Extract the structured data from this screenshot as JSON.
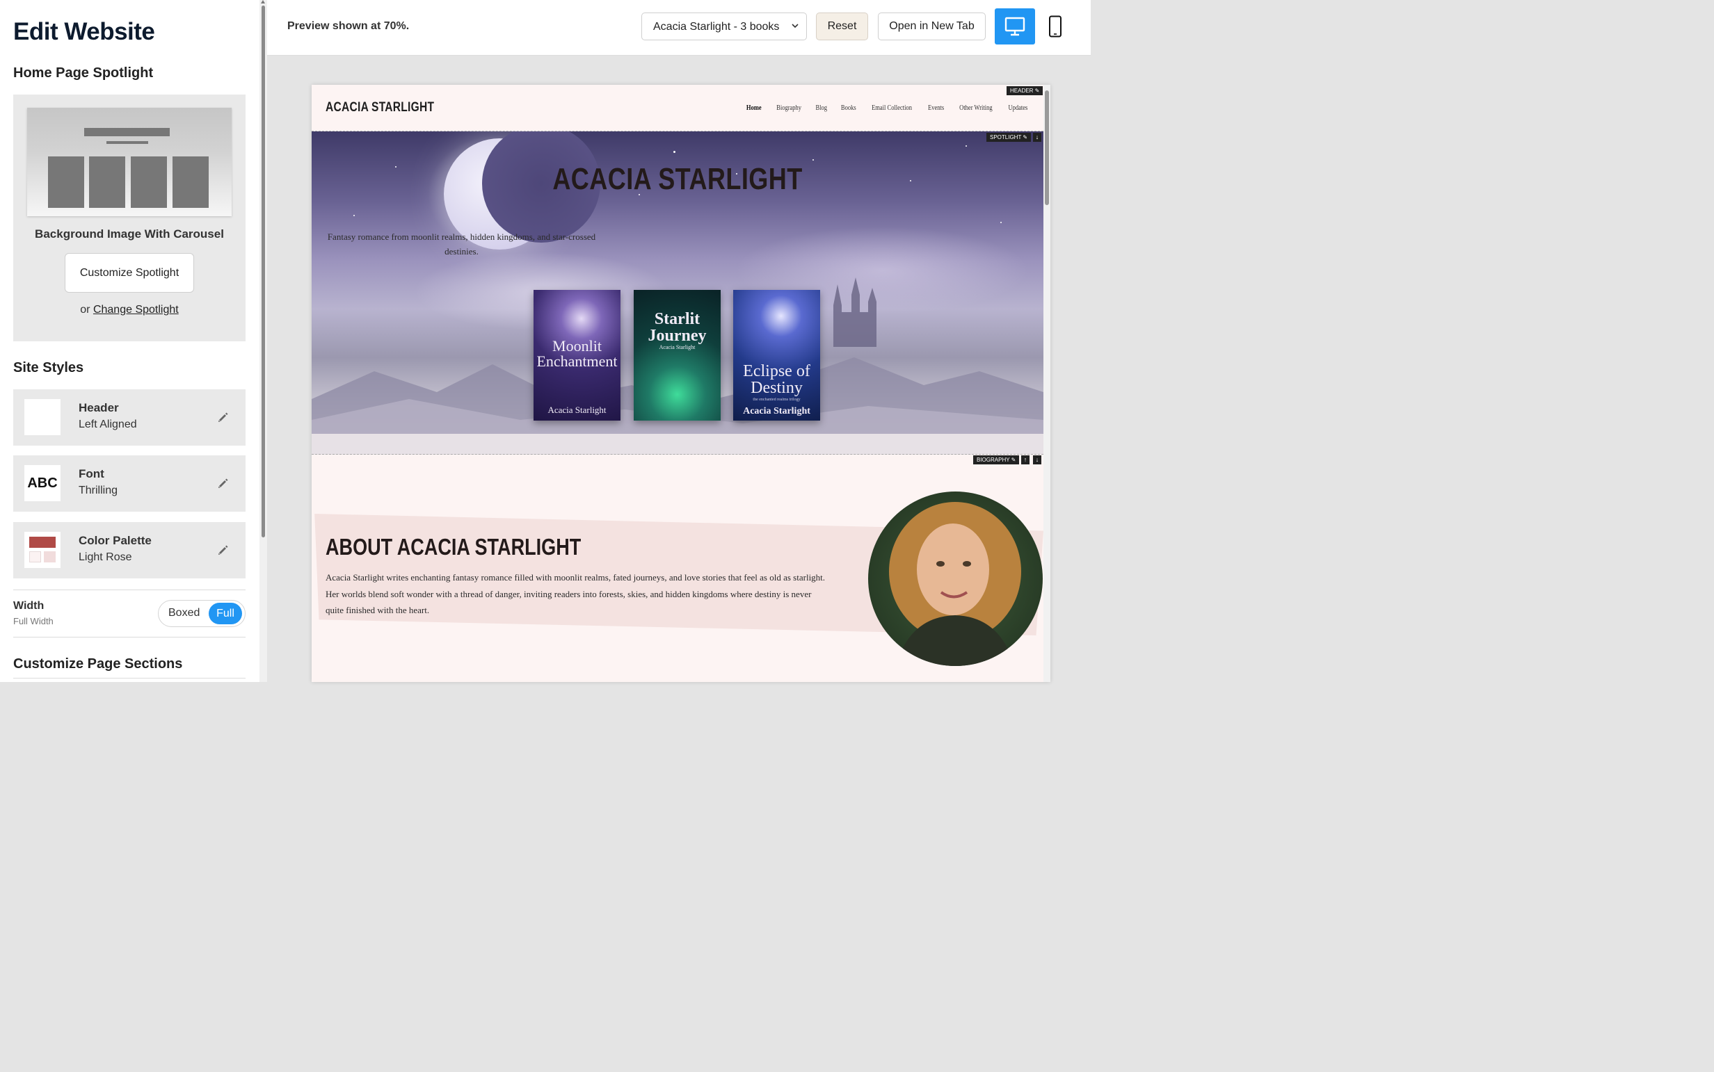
{
  "sidebar": {
    "title": "Edit Website",
    "spotlight": {
      "heading": "Home Page Spotlight",
      "name": "Background Image With Carousel",
      "customize_label": "Customize Spotlight",
      "or_text": "or",
      "change_label": "Change Spotlight"
    },
    "site_styles": {
      "heading": "Site Styles",
      "header": {
        "name": "Header",
        "value": "Left Aligned"
      },
      "font": {
        "name": "Font",
        "value": "Thrilling",
        "sample": "ABC"
      },
      "palette": {
        "name": "Color Palette",
        "value": "Light Rose",
        "colors": [
          "#b04a46",
          "#fbf2f2",
          "#f1dcdc"
        ]
      }
    },
    "width": {
      "label": "Width",
      "value": "Full Width",
      "options": [
        "Boxed",
        "Full"
      ],
      "selected": "Full"
    },
    "sections_heading": "Customize Page Sections"
  },
  "topbar": {
    "preview_text": "Preview shown at 70%.",
    "select_value": "Acacia Starlight - 3 books",
    "reset_label": "Reset",
    "new_tab_label": "Open in New Tab",
    "accent": "#2196f3"
  },
  "site": {
    "logo": "ACACIA STARLIGHT",
    "nav": [
      "Home",
      "Biography",
      "Blog",
      "Books",
      "Email Collection",
      "Events",
      "Other Writing",
      "Updates"
    ],
    "tags": {
      "header": "HEADER ✎",
      "spotlight": "SPOTLIGHT ✎",
      "biography": "BIOGRAPHY ✎",
      "up": "↑",
      "down": "↓"
    },
    "hero": {
      "title": "ACACIA STARLIGHT",
      "tagline": "Fantasy romance from moonlit realms, hidden kingdoms, and star-crossed destinies."
    },
    "books": [
      {
        "title": "Moonlit Enchantment",
        "author": "Acacia Starlight"
      },
      {
        "title": "Starlit Journey",
        "author": "Acacia Starlight"
      },
      {
        "title": "Eclipse of Destiny",
        "subtitle": "the enchanted realms trilogy",
        "author": "Acacia Starlight"
      }
    ],
    "bio": {
      "title": "ABOUT ACACIA STARLIGHT",
      "text": "Acacia Starlight writes enchanting fantasy romance filled with moonlit realms, fated journeys, and love stories that feel as old as starlight. Her worlds blend soft wonder with a thread of danger, inviting readers into forests, skies, and hidden kingdoms where destiny is never quite finished with the heart."
    }
  }
}
